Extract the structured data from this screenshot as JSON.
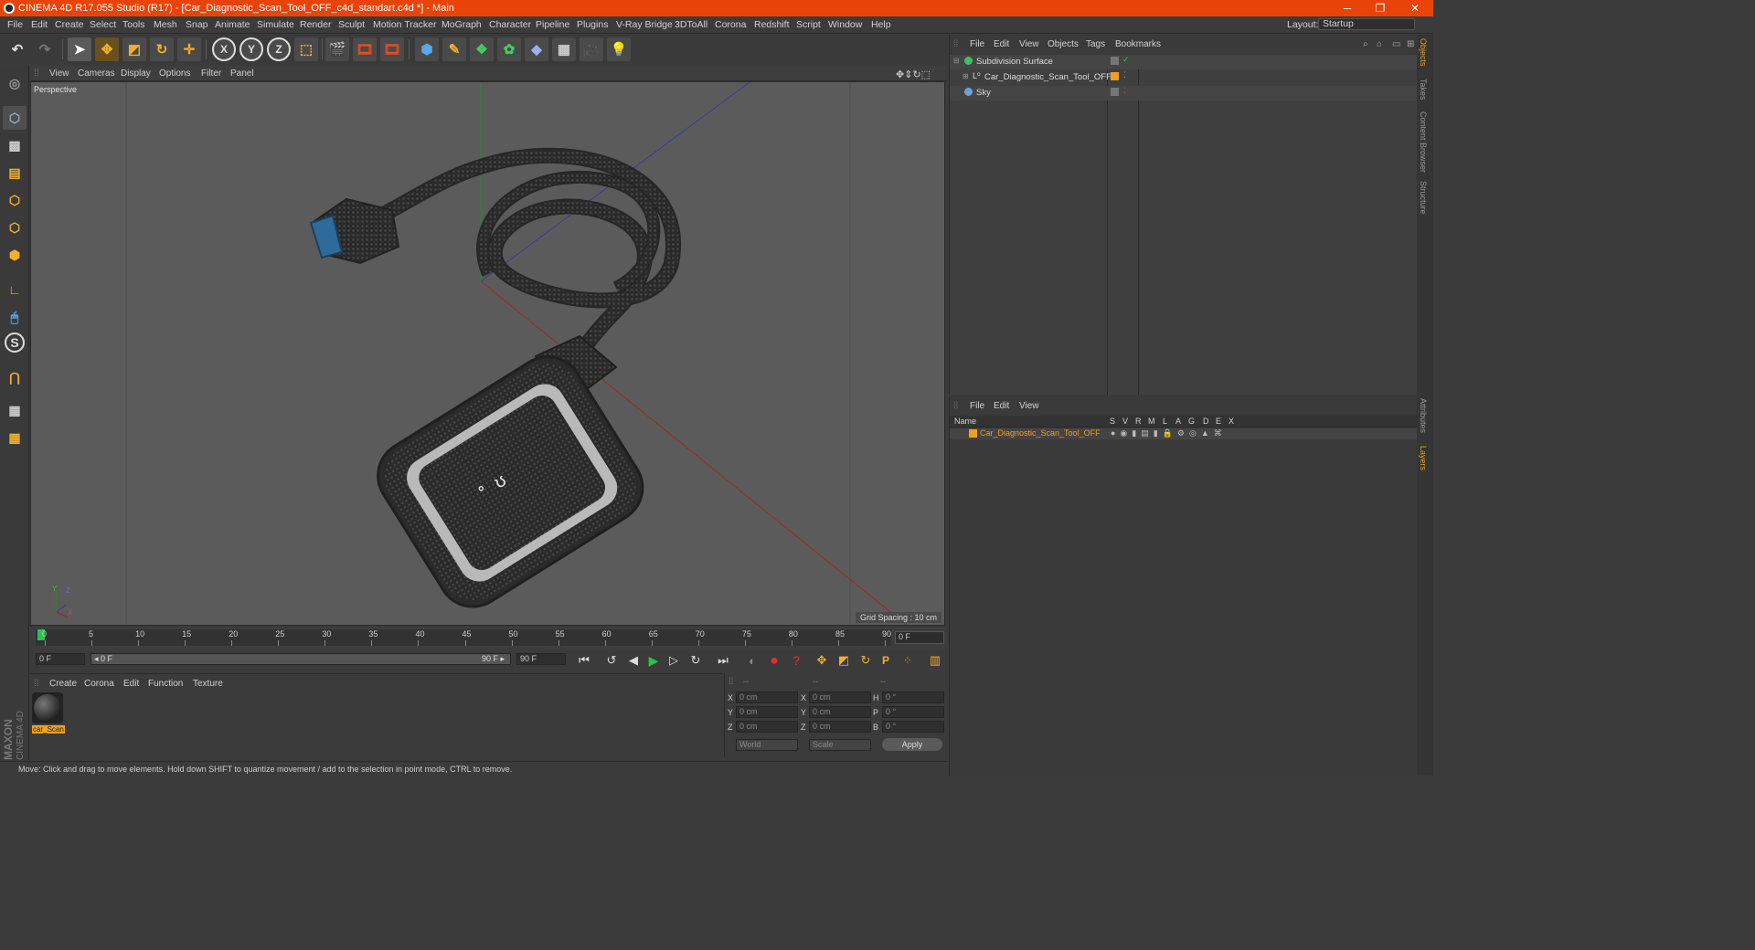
{
  "window": {
    "title": "CINEMA 4D R17.055 Studio (R17) - [Car_Diagnostic_Scan_Tool_OFF_c4d_standart.c4d *] - Main",
    "minimize": "─",
    "maximize": "❐",
    "close": "✕"
  },
  "menu": [
    "File",
    "Edit",
    "Create",
    "Select",
    "Tools",
    "Mesh",
    "Snap",
    "Animate",
    "Simulate",
    "Render",
    "Sculpt",
    "Motion Tracker",
    "MoGraph",
    "Character",
    "Pipeline",
    "Plugins",
    "V-Ray Bridge",
    "3DToAll",
    "Corona",
    "Redshift",
    "Script",
    "Window",
    "Help"
  ],
  "layout": {
    "label": "Layout:",
    "value": "Startup"
  },
  "toolbar": {
    "axis_x": "X",
    "axis_y": "Y",
    "axis_z": "Z"
  },
  "viewport": {
    "menu": [
      "View",
      "Cameras",
      "Display",
      "Options",
      "Filter",
      "Panel"
    ],
    "name": "Perspective",
    "grid_spacing": "Grid Spacing : 10 cm",
    "axis_y": "Y",
    "axis_z": "Z",
    "axis_x": "X"
  },
  "timeline": {
    "ticks": [
      "0",
      "5",
      "10",
      "15",
      "20",
      "25",
      "30",
      "35",
      "40",
      "45",
      "50",
      "55",
      "60",
      "65",
      "70",
      "75",
      "80",
      "85",
      "90"
    ],
    "current": "0 F"
  },
  "transport": {
    "start": "0 F",
    "range_start": "◂ 0 F",
    "range_end": "90 F ▸",
    "end": "90 F"
  },
  "materials": {
    "menu": [
      "Create",
      "Corona",
      "Edit",
      "Function",
      "Texture"
    ],
    "items": [
      {
        "name": "car_Scan"
      }
    ]
  },
  "coords": {
    "headers": [
      "--",
      "--",
      "--"
    ],
    "rows": [
      {
        "a": "X",
        "av": "0 cm",
        "b": "X",
        "bv": "0 cm",
        "c": "H",
        "cv": "0 °"
      },
      {
        "a": "Y",
        "av": "0 cm",
        "b": "Y",
        "bv": "0 cm",
        "c": "P",
        "cv": "0 °"
      },
      {
        "a": "Z",
        "av": "0 cm",
        "b": "Z",
        "bv": "0 cm",
        "c": "B",
        "cv": "0 °"
      }
    ],
    "world": "World",
    "scale": "Scale",
    "apply": "Apply"
  },
  "status": "Move: Click and drag to move elements. Hold down SHIFT to quantize movement / add to the selection in point mode, CTRL to remove.",
  "objects": {
    "menu": [
      "File",
      "Edit",
      "View",
      "Objects",
      "Tags",
      "Bookmarks"
    ],
    "items": [
      {
        "name": "Subdivision Surface"
      },
      {
        "name": "Car_Diagnostic_Scan_Tool_OFF"
      },
      {
        "name": "Sky"
      }
    ]
  },
  "layers": {
    "menu": [
      "File",
      "Edit",
      "View"
    ],
    "col_name": "Name",
    "cols": [
      "S",
      "V",
      "R",
      "M",
      "L",
      "A",
      "G",
      "D",
      "E",
      "X"
    ],
    "items": [
      {
        "name": "Car_Diagnostic_Scan_Tool_OFF"
      }
    ]
  },
  "side_tabs": [
    "Objects",
    "Takes",
    "Content Browser",
    "Structure"
  ],
  "side_tabs2": [
    "Attributes",
    "Layers"
  ],
  "brand": {
    "maxon": "MAXON",
    "c4d": "CINEMA 4D"
  },
  "colors": {
    "title_bar": "#e8440a",
    "accent_orange": "#f0a020",
    "layer_name": "#f0a020"
  }
}
